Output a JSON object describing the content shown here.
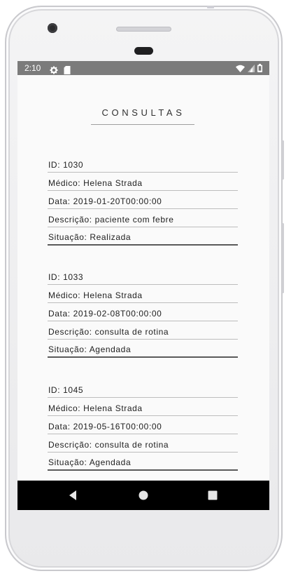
{
  "status_bar": {
    "time": "2:10",
    "left_icons": [
      "gear-icon",
      "sd-card-icon"
    ],
    "right_icons": [
      "wifi-icon",
      "signal-icon",
      "battery-icon"
    ]
  },
  "page": {
    "title": "CONSULTAS"
  },
  "consultas": [
    {
      "id": "ID: 1030",
      "medico": "Médico: Helena Strada",
      "data": "Data: 2019-01-20T00:00:00",
      "descricao": "Descrição: paciente com febre",
      "situacao": "Situação: Realizada"
    },
    {
      "id": "ID: 1033",
      "medico": "Médico: Helena Strada",
      "data": "Data: 2019-02-08T00:00:00",
      "descricao": "Descrição: consulta de rotina",
      "situacao": "Situação: Agendada"
    },
    {
      "id": "ID: 1045",
      "medico": "Médico: Helena Strada",
      "data": "Data: 2019-05-16T00:00:00",
      "descricao": "Descrição: consulta de rotina",
      "situacao": "Situação: Agendada"
    }
  ],
  "nav_bar": {
    "buttons": [
      "back-icon",
      "home-icon",
      "recents-icon"
    ]
  },
  "colors": {
    "status_bar": "#7b7b7b",
    "screen_background": "#fafafa",
    "nav_bar": "#000000",
    "text": "#212121"
  }
}
